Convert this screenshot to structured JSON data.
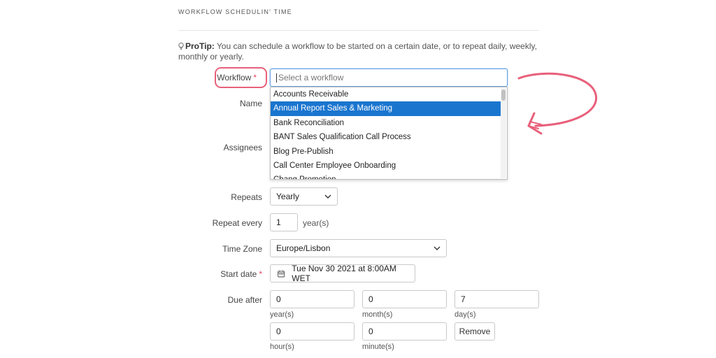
{
  "section": {
    "title": "WORKFLOW SCHEDULIN' TIME"
  },
  "protip": {
    "label": "ProTip:",
    "text": " You can schedule a workflow to be started on a certain date, or to repeat daily, weekly, monthly or yearly."
  },
  "labels": {
    "workflow": "Workflow",
    "name": "Name",
    "assignees": "Assignees",
    "repeats": "Repeats",
    "repeat_every": "Repeat every",
    "time_zone": "Time Zone",
    "start_date": "Start date",
    "due_after": "Due after",
    "required_mark": "*"
  },
  "workflow_select": {
    "placeholder": "Select a workflow",
    "options": [
      "Accounts Receivable",
      "Annual Report Sales & Marketing",
      "Bank Reconciliation",
      "BANT Sales Qualification Call Process",
      "Blog Pre-Publish",
      "Call Center Employee Onboarding",
      "Chang Promotion"
    ],
    "highlighted_index": 1
  },
  "repeats": {
    "value": "Yearly"
  },
  "repeat_every": {
    "value": "1",
    "unit": "year(s)"
  },
  "time_zone": {
    "value": "Europe/Lisbon"
  },
  "start_date": {
    "value": "Tue Nov 30 2021 at 8:00AM WET"
  },
  "due_after": {
    "years": "0",
    "years_label": "year(s)",
    "months": "0",
    "months_label": "month(s)",
    "days": "7",
    "days_label": "day(s)",
    "hours": "0",
    "hours_label": "hour(s)",
    "minutes": "0",
    "minutes_label": "minute(s)",
    "remove_label": "Remove"
  },
  "colors": {
    "accent": "#1a75cf",
    "annotation": "#e8607a",
    "required": "#e0455c"
  }
}
